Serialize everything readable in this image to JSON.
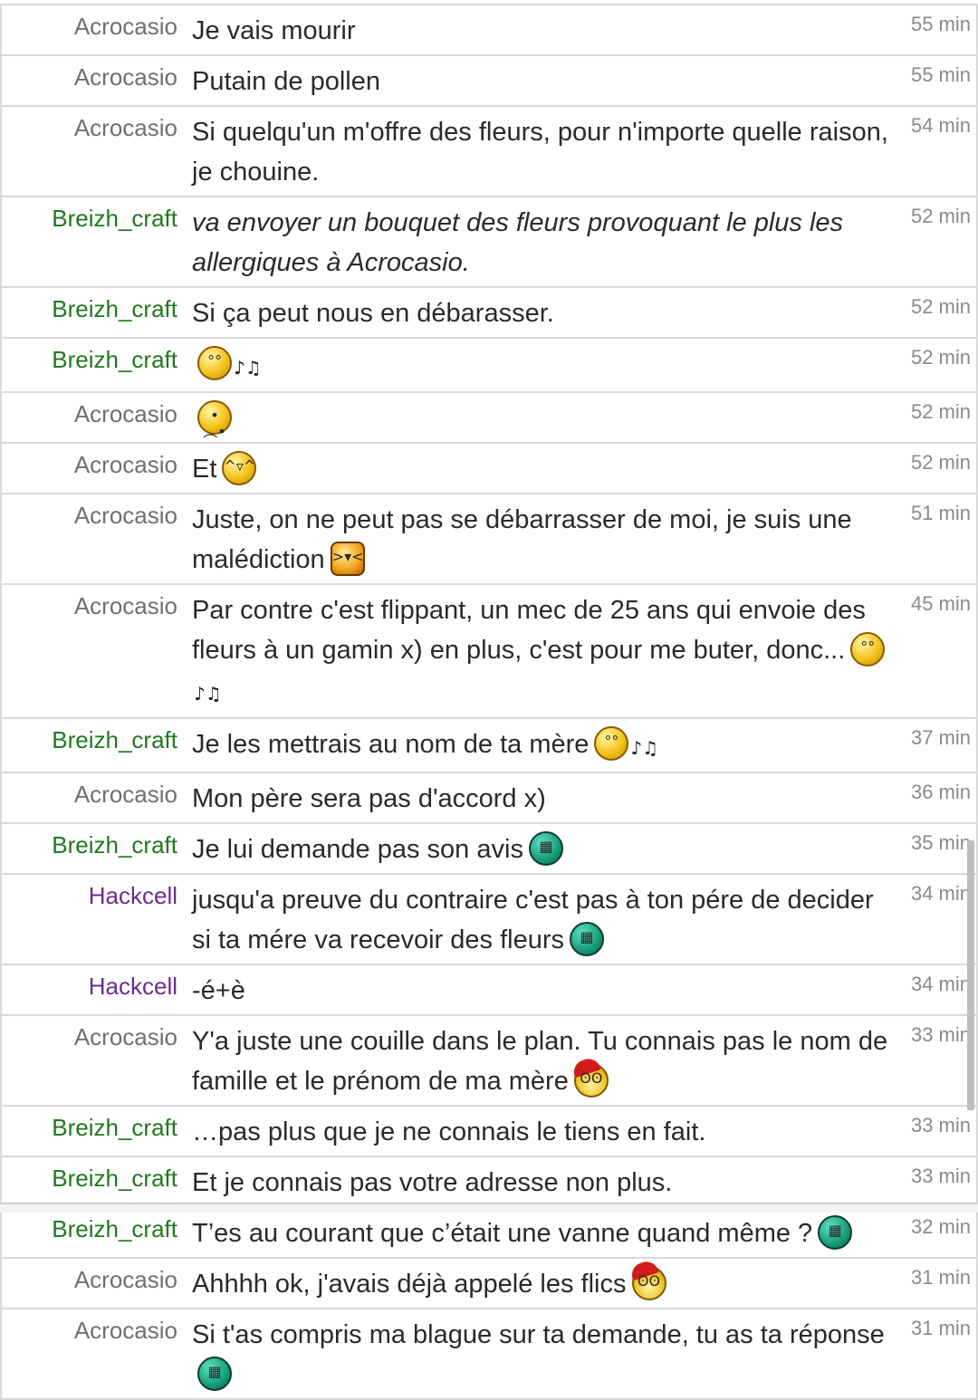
{
  "messages": [
    {
      "user": "Acrocasio",
      "user_class": "u-acro",
      "text": "Je vais mourir",
      "time": "55 min"
    },
    {
      "user": "Acrocasio",
      "user_class": "u-acro",
      "text": "Putain de pollen",
      "time": "55 min"
    },
    {
      "user": "Acrocasio",
      "user_class": "u-acro",
      "text": "Si quelqu'un m'offre des fleurs, pour n'importe quelle raison, je chouine.",
      "time": "54 min"
    },
    {
      "user": "Breizh_craft",
      "user_class": "u-breizh",
      "text": "va envoyer un bouquet des fleurs provoquant le plus les allergiques à Acrocasio.",
      "time": "52 min",
      "action": true
    },
    {
      "user": "Breizh_craft",
      "user_class": "u-breizh",
      "text": "Si ça peut nous en débarasser.",
      "time": "52 min"
    },
    {
      "user": "Breizh_craft",
      "user_class": "u-breizh",
      "text": "",
      "time": "52 min",
      "emoji": "whistle-emoji"
    },
    {
      "user": "Acrocasio",
      "user_class": "u-acro",
      "text": "",
      "time": "52 min",
      "emoji": "sad-emoji"
    },
    {
      "user": "Acrocasio",
      "user_class": "u-acro",
      "text": "Et",
      "time": "52 min",
      "emoji": "laugh-emoji"
    },
    {
      "user": "Acrocasio",
      "user_class": "u-acro",
      "text": "Juste, on ne peut pas se débarrasser de moi, je suis une malédiction",
      "time": "51 min",
      "emoji": "devil-emoji"
    },
    {
      "user": "Acrocasio",
      "user_class": "u-acro",
      "text": "Par contre c'est flippant, un mec de 25 ans qui envoie des fleurs à un gamin x) en plus, c'est pour me buter, donc...",
      "time": "45 min",
      "emoji": "whistle-emoji"
    },
    {
      "user": "Breizh_craft",
      "user_class": "u-breizh",
      "text": "Je les mettrais au nom de ta mère",
      "time": "37 min",
      "emoji": "whistle-emoji"
    },
    {
      "user": "Acrocasio",
      "user_class": "u-acro",
      "text": "Mon père sera pas d'accord x)",
      "time": "36 min"
    },
    {
      "user": "Breizh_craft",
      "user_class": "u-breizh",
      "text": "Je lui demande pas son avis",
      "time": "35 min",
      "emoji": "grin-green-emoji"
    },
    {
      "user": "Hackcell",
      "user_class": "u-hack",
      "text": "jusqu'a preuve du contraire c'est pas à ton pére de decider si ta mére va recevoir des fleurs",
      "time": "34 min",
      "emoji": "grin-green-emoji"
    },
    {
      "user": "Hackcell",
      "user_class": "u-hack",
      "text": "-é+è",
      "time": "34 min"
    },
    {
      "user": "Acrocasio",
      "user_class": "u-acro",
      "text": "Y'a juste une couille dans le plan. Tu connais pas le nom de famille et le prénom de ma mère",
      "time": "33 min",
      "emoji": "santa-emoji"
    },
    {
      "user": "Breizh_craft",
      "user_class": "u-breizh",
      "text": "…pas plus que je ne connais le tiens en fait.",
      "time": "33 min"
    },
    {
      "user": "Breizh_craft",
      "user_class": "u-breizh",
      "text": "Et je connais pas votre adresse non plus.",
      "time": "33 min"
    },
    {
      "user": "Breizh_craft",
      "user_class": "u-breizh",
      "text": "T’es au courant que c’était une vanne quand même ?",
      "time": "32 min",
      "emoji": "grin-green-emoji"
    },
    {
      "user": "Acrocasio",
      "user_class": "u-acro",
      "text": "Ahhhh ok, j'avais déjà appelé les flics",
      "time": "31 min",
      "emoji": "santa-emoji"
    },
    {
      "user": "Acrocasio",
      "user_class": "u-acro",
      "text": "Si t'as compris ma blague sur ta demande, tu as ta réponse",
      "time": "31 min",
      "emoji": "grin-green-emoji"
    }
  ],
  "colors": {
    "acrocasio": "#707070",
    "breizh_craft": "#1e7a1e",
    "hackcell": "#6b2c91",
    "border": "#d9d9d9",
    "time": "#8a8a8a"
  }
}
